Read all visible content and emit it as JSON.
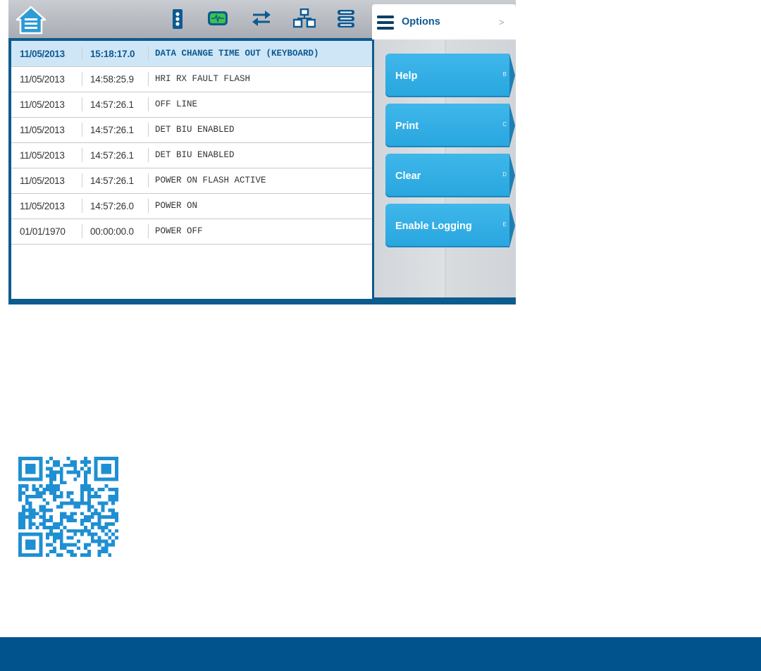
{
  "toolbar": {
    "icons": [
      "home-icon",
      "traffic-signal-icon",
      "monitor-icon",
      "transfer-arrows-icon",
      "network-icon",
      "list-icon"
    ]
  },
  "event_log": {
    "rows": [
      {
        "date": "11/05/2013",
        "time": "15:18:17.0",
        "event": "DATA CHANGE TIME OUT (KEYBOARD)",
        "selected": true
      },
      {
        "date": "11/05/2013",
        "time": "14:58:25.9",
        "event": "HRI RX FAULT FLASH",
        "selected": false
      },
      {
        "date": "11/05/2013",
        "time": "14:57:26.1",
        "event": "OFF LINE",
        "selected": false
      },
      {
        "date": "11/05/2013",
        "time": "14:57:26.1",
        "event": "DET BIU ENABLED",
        "selected": false
      },
      {
        "date": "11/05/2013",
        "time": "14:57:26.1",
        "event": "DET BIU ENABLED",
        "selected": false
      },
      {
        "date": "11/05/2013",
        "time": "14:57:26.1",
        "event": "POWER ON FLASH ACTIVE",
        "selected": false
      },
      {
        "date": "11/05/2013",
        "time": "14:57:26.0",
        "event": "POWER ON",
        "selected": false
      },
      {
        "date": "01/01/1970",
        "time": "00:00:00.0",
        "event": "POWER OFF",
        "selected": false
      }
    ]
  },
  "options": {
    "tab_label": "Options",
    "tab_chevron": ">",
    "buttons": [
      {
        "label": "Help",
        "key": "B"
      },
      {
        "label": "Print",
        "key": "C"
      },
      {
        "label": "Clear",
        "key": "D"
      },
      {
        "label": "Enable Logging",
        "key": "E"
      }
    ]
  },
  "colors": {
    "brand_blue": "#00538c",
    "button_blue": "#2eaae2",
    "selected_row": "#cfe6f6"
  }
}
